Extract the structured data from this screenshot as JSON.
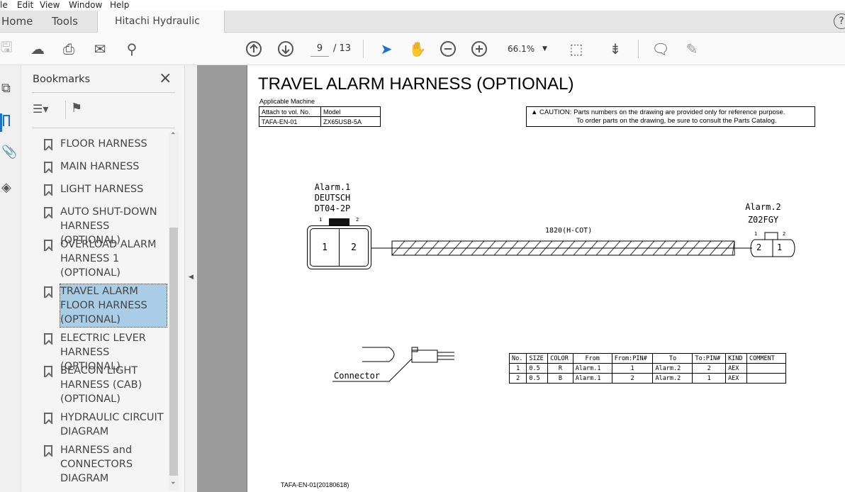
{
  "menu": [
    "le",
    "Edit",
    "View",
    "Window",
    "Help"
  ],
  "tabs": {
    "home": "Home",
    "tools": "Tools",
    "document": "Hitachi Hydraulic Ex...",
    "close": "×",
    "help": "?"
  },
  "toolbar": {
    "page_current": "9",
    "page_total": "/ 13",
    "zoom": "66.1%"
  },
  "bookmarks": {
    "title": "Bookmarks",
    "close": "×",
    "items": [
      {
        "label": "FLOOR HARNESS"
      },
      {
        "label": "MAIN HARNESS"
      },
      {
        "label": "LIGHT HARNESS"
      },
      {
        "label": "AUTO SHUT-DOWN HARNESS (OPTIONAL)"
      },
      {
        "label": "OVERLOAD ALARM HARNESS 1 (OPTIONAL)"
      },
      {
        "label": "TRAVEL ALARM FLOOR HARNESS (OPTIONAL)",
        "selected": true
      },
      {
        "label": "ELECTRIC LEVER HARNESS (OPTIONAL)"
      },
      {
        "label": "BEACON LIGHT HARNESS (CAB) (OPTIONAL)"
      },
      {
        "label": "HYDRAULIC CIRCUIT DIAGRAM"
      },
      {
        "label": "HARNESS and CONNECTORS DIAGRAM"
      }
    ]
  },
  "doc": {
    "title": "TRAVEL ALARM HARNESS (OPTIONAL)",
    "applicable": "Applicable Machine",
    "app_headers": [
      "Attach to vol. No.",
      "Model"
    ],
    "app_values": [
      "TAFA-EN-01",
      "ZX65USB-5A"
    ],
    "caution1": "▲ CAUTION: Parts numbers on the drawing are provided only for reference purpose.",
    "caution2": "To order parts on the drawing, be sure to consult the Parts Catalog.",
    "conn1": [
      "Alarm.1",
      "DEUTSCH",
      "DT04-2P"
    ],
    "conn1_pins": [
      "1",
      "2"
    ],
    "conn2": [
      "Alarm.2",
      "Z02FGY"
    ],
    "conn2_pins": [
      "2",
      "1"
    ],
    "pin_small": [
      "1",
      "2"
    ],
    "wire": "1820(H-COT)",
    "connector_label": "Connector",
    "table_headers": [
      "No.",
      "SIZE",
      "COLOR",
      "From",
      "From:PIN#",
      "To",
      "To:PIN#",
      "KIND",
      "COMMENT"
    ],
    "table_rows": [
      [
        "1",
        "0.5",
        "R",
        "Alarm.1",
        "1",
        "Alarm.2",
        "2",
        "AEX",
        ""
      ],
      [
        "2",
        "0.5",
        "B",
        "Alarm.1",
        "2",
        "Alarm.2",
        "1",
        "AEX",
        ""
      ]
    ],
    "footer": "TAFA-EN-01(20180618)"
  }
}
